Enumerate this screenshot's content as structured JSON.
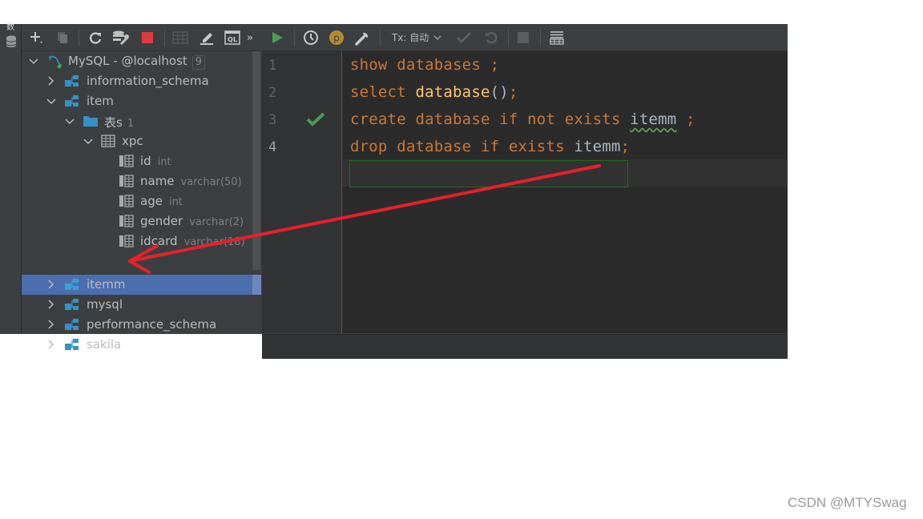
{
  "left_strip": {
    "tab_glyph": "数",
    "db_tool_icon": "database-icon"
  },
  "toolbar_left": {
    "buttons": [
      {
        "name": "add-button",
        "icon": "plus-icon"
      },
      {
        "name": "duplicate-button",
        "icon": "copy-icon"
      },
      {
        "name": "refresh-button",
        "icon": "refresh-icon"
      },
      {
        "name": "db-properties-button",
        "icon": "db-wrench-icon"
      },
      {
        "name": "stop-button",
        "icon": "stop-icon"
      },
      {
        "name": "table-view-button",
        "icon": "table-icon"
      },
      {
        "name": "edit-button",
        "icon": "pencil-icon"
      },
      {
        "name": "query-console-button",
        "icon": "ql-icon"
      },
      {
        "name": "more-button",
        "icon": "double-chevron-icon"
      }
    ],
    "more_label": "»"
  },
  "toolbar_right": {
    "tx_label": "Tx: 自动",
    "buttons": [
      {
        "name": "execute-button",
        "icon": "play-icon"
      },
      {
        "name": "history-button",
        "icon": "clock-icon"
      },
      {
        "name": "profile-button",
        "icon": "p-icon",
        "label": "p"
      },
      {
        "name": "settings-button",
        "icon": "wrench-icon"
      },
      {
        "name": "commit-button",
        "icon": "check-icon"
      },
      {
        "name": "rollback-button",
        "icon": "undo-icon"
      },
      {
        "name": "cancel-button",
        "icon": "stop-icon"
      },
      {
        "name": "output-button",
        "icon": "table-rows-icon"
      }
    ],
    "accent_run": "#499c54",
    "accent_profile": "#b58c2b"
  },
  "tree": {
    "connection": {
      "label": "MySQL - @localhost",
      "count": "9"
    },
    "items": [
      {
        "label": "information_schema",
        "expanded": false
      },
      {
        "label": "item",
        "expanded": true,
        "children": [
          {
            "label": "表s",
            "count": "1",
            "expanded": true,
            "children": [
              {
                "label": "xpc",
                "expanded": true,
                "columns": [
                  {
                    "name": "id",
                    "type": "int"
                  },
                  {
                    "name": "name",
                    "type": "varchar(50)"
                  },
                  {
                    "name": "age",
                    "type": "int"
                  },
                  {
                    "name": "gender",
                    "type": "varchar(2)"
                  },
                  {
                    "name": "idcard",
                    "type": "varchar(18)"
                  }
                ]
              }
            ]
          }
        ]
      },
      {
        "label": "itemm",
        "expanded": false,
        "selected": true
      },
      {
        "label": "mysql",
        "expanded": false
      },
      {
        "label": "performance_schema",
        "expanded": false
      },
      {
        "label": "sakila",
        "expanded": false
      }
    ],
    "selection_color": "#4b6eaf"
  },
  "editor": {
    "line_numbers": [
      "1",
      "2",
      "3",
      "4"
    ],
    "current_line": 4,
    "executed_line": 3,
    "lines": [
      [
        {
          "t": "show",
          "c": "kw"
        },
        {
          "t": " ",
          "c": "id"
        },
        {
          "t": "databases",
          "c": "kw"
        },
        {
          "t": " ;",
          "c": "pun"
        }
      ],
      [
        {
          "t": "select",
          "c": "kw"
        },
        {
          "t": " ",
          "c": "id"
        },
        {
          "t": "database",
          "c": "fn"
        },
        {
          "t": "()",
          "c": "paren"
        },
        {
          "t": ";",
          "c": "pun"
        }
      ],
      [
        {
          "t": "create",
          "c": "kw"
        },
        {
          "t": " ",
          "c": "id"
        },
        {
          "t": "database",
          "c": "kw"
        },
        {
          "t": " ",
          "c": "id"
        },
        {
          "t": "if",
          "c": "kw"
        },
        {
          "t": " ",
          "c": "id"
        },
        {
          "t": "not",
          "c": "kw"
        },
        {
          "t": " ",
          "c": "id"
        },
        {
          "t": "exists",
          "c": "kw"
        },
        {
          "t": " ",
          "c": "id"
        },
        {
          "t": "itemm",
          "c": "id squig"
        },
        {
          "t": " ;",
          "c": "pun"
        }
      ],
      [
        {
          "t": "drop",
          "c": "kw"
        },
        {
          "t": " ",
          "c": "id"
        },
        {
          "t": "database",
          "c": "kw"
        },
        {
          "t": " ",
          "c": "id"
        },
        {
          "t": "if",
          "c": "kw"
        },
        {
          "t": " ",
          "c": "id"
        },
        {
          "t": "exists",
          "c": "kw"
        },
        {
          "t": " ",
          "c": "id"
        },
        {
          "t": "itemm",
          "c": "id"
        },
        {
          "t": ";",
          "c": "pun"
        }
      ]
    ]
  },
  "annotation": {
    "type": "red-arrow",
    "from": "editor line 4 (itemm)",
    "to": "tree item itemm",
    "color": "#e8202a"
  },
  "watermark": "CSDN @MTYSwag"
}
